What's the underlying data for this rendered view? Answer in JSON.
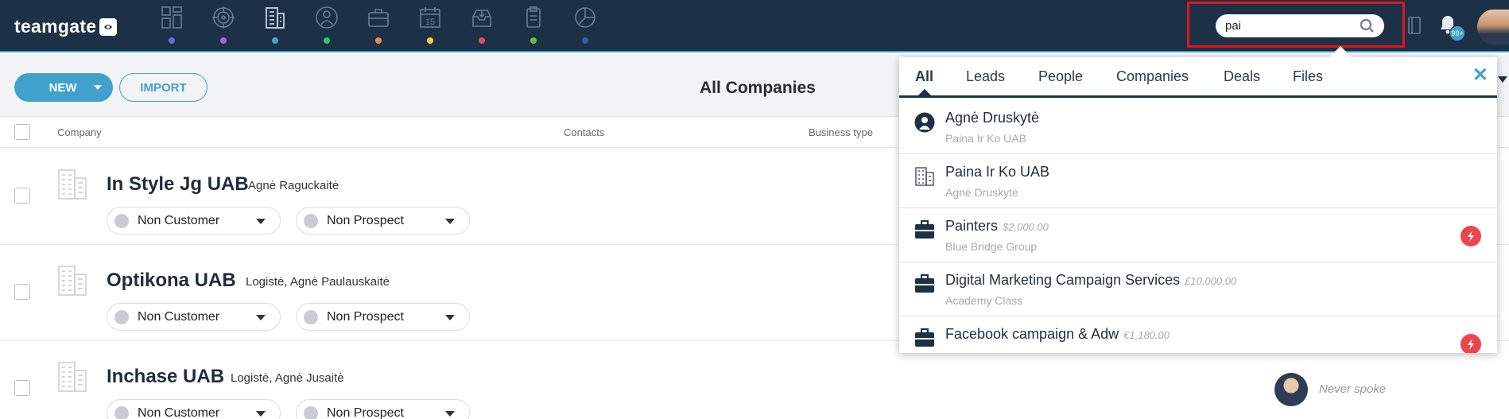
{
  "app": {
    "logo_text": "teamgate"
  },
  "nav_colors": [
    "#5a6fe0",
    "#b05ee6",
    "#3fa1cc",
    "#28c76f",
    "#f08b3a",
    "#f4d03f",
    "#e8486a",
    "#5bc43a",
    "#2e5fa8"
  ],
  "nav_icons": [
    "dashboard-icon",
    "target-icon",
    "companies-icon",
    "people-icon",
    "deals-icon",
    "calendar-icon",
    "inbox-icon",
    "clipboard-icon",
    "reports-icon"
  ],
  "calendar_day": "15",
  "search": {
    "value": "pai",
    "placeholder": ""
  },
  "notifications": {
    "badge": "99+"
  },
  "toolbar": {
    "new_label": "NEW",
    "import_label": "IMPORT",
    "view_title": "All Companies"
  },
  "table": {
    "headers": {
      "company": "Company",
      "contacts": "Contacts",
      "business_type": "Business type"
    },
    "rows": [
      {
        "name": "In Style Jg UAB",
        "contacts": "Agnė Raguckaitė",
        "customer_status": "Non Customer",
        "prospect_status": "Non Prospect",
        "last_contact": ""
      },
      {
        "name": "Optikona UAB",
        "contacts": "Logistė, Agnė Paulauskaitė",
        "customer_status": "Non Customer",
        "prospect_status": "Non Prospect",
        "last_contact": ""
      },
      {
        "name": "Inchase UAB",
        "contacts": "Logistė, Agnė Jusaitė",
        "customer_status": "Non Customer",
        "prospect_status": "Non Prospect",
        "last_contact": "Never spoke"
      }
    ]
  },
  "search_dropdown": {
    "tabs": [
      "All",
      "Leads",
      "People",
      "Companies",
      "Deals",
      "Files"
    ],
    "active_tab": "All",
    "close_label": "✕",
    "results": [
      {
        "type": "person",
        "icon": "person-icon",
        "title": "Agnė Druskytė",
        "amount": "",
        "subtitle": "Paina Ir Ko UAB",
        "flag": false
      },
      {
        "type": "company",
        "icon": "building-icon",
        "title": "Paina Ir Ko UAB",
        "amount": "",
        "subtitle": "Agnė Druskytė",
        "flag": false
      },
      {
        "type": "deal",
        "icon": "briefcase-icon",
        "title": "Painters",
        "amount": "$2,000.00",
        "subtitle": "Blue Bridge Group",
        "flag": true
      },
      {
        "type": "deal",
        "icon": "briefcase-icon",
        "title": "Digital Marketing Campaign Services",
        "amount": "£10,000.00",
        "subtitle": "Academy Class",
        "flag": false
      },
      {
        "type": "deal",
        "icon": "briefcase-icon",
        "title": "Facebook campaign & Adw",
        "amount": "€1,180.00",
        "subtitle": "",
        "flag": true
      }
    ]
  }
}
